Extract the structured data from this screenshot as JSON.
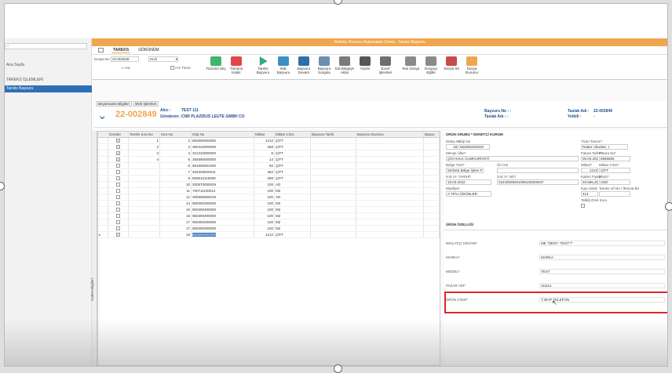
{
  "left_nav": {
    "search_placeholder": "",
    "items": [
      {
        "label": "Ana Sayfa",
        "active": false
      },
      {
        "label": "TAREKS İŞLEMLERİ",
        "active": false
      },
      {
        "label": "Tareks Başvuru",
        "active": true
      }
    ]
  },
  "titlebar": {
    "title": "Robotic Process Automation Demo - Tareks Başvuru"
  },
  "ribbon_tabs": [
    "TAREKS",
    "GÖRÜNÜM"
  ],
  "ribbon": {
    "dosya_no_label": "Dosya No",
    "dosya_no_value": "22-002849",
    "hizli_value": "Hızlı",
    "ara_label": "Ara",
    "hiz_tumu_label": "Hız Tümü",
    "buttons": [
      "Tümünü Seç",
      "Tümünü Kaldır",
      "Tareks Başvuru",
      "XML Başvuru",
      "Başvuru Devam",
      "Başvuru Sorgula",
      "Edi Belgeye Aktar",
      "Yazdır",
      "Excel İşlemleri",
      "Yeni Dosya",
      "Dosyayı Eğitle",
      "Dosya Sil",
      "Dosya Durumu"
    ]
  },
  "info": {
    "tabs": [
      "Beyanname Bilgileri",
      "Web İşlemleri"
    ],
    "file_no": "22-002849",
    "alici_label": "Alıcı :",
    "alici_value": "TEST 111",
    "gonderen_label": "Gönderen :",
    "gonderen_value": "CNR PLAZIDUS LEUTE GMBH CO",
    "basvuru_no_label": "Başvuru No : -",
    "taslak_adi_label": "Taslak Adı :",
    "taslak_adi_value": "22-002849",
    "tarih_label": "Taslak Adı : -",
    "yetkili_label": "Yetkili :",
    "yetkili_value": "-"
  },
  "grid": {
    "side_label": "Kalem Bilgileri",
    "headers": [
      "Gönder",
      "Tareks Sıra No",
      "Sıra No",
      "Gtip No",
      "Miktar",
      "Miktar Cinsi",
      "Başvuru Tarihi",
      "Başvuru Durumu",
      "Başvu"
    ],
    "rows": [
      {
        "send": true,
        "tareks": "1",
        "sira": "2",
        "gtip": "852692002000",
        "miktar": "1212",
        "cins": "ÇİFT"
      },
      {
        "send": true,
        "tareks": "2",
        "sira": "3",
        "gtip": "360410000000",
        "miktar": "368",
        "cins": "ÇİFT"
      },
      {
        "send": true,
        "tareks": "3",
        "sira": "4",
        "gtip": "321310000000",
        "miktar": "6",
        "cins": "ÇİFT"
      },
      {
        "send": true,
        "tareks": "4",
        "sira": "5",
        "gtip": "392690000000",
        "miktar": "14",
        "cins": "ÇİFT"
      },
      {
        "send": false,
        "tareks": "",
        "sira": "6",
        "gtip": "961900301000",
        "miktar": "92",
        "cins": "ÇİFT"
      },
      {
        "send": false,
        "tareks": "",
        "sira": "7",
        "gtip": "252329000011",
        "miktar": "362",
        "cins": "ÇİFT"
      },
      {
        "send": false,
        "tareks": "",
        "sira": "8",
        "gtip": "850610110000",
        "miktar": "299",
        "cins": "ÇİFT"
      },
      {
        "send": false,
        "tareks": "",
        "sira": "10",
        "gtip": "200570000029",
        "miktar": "100",
        "cins": "AD"
      },
      {
        "send": false,
        "tareks": "",
        "sira": "11",
        "gtip": "700711100012",
        "miktar": "100",
        "cins": "M2"
      },
      {
        "send": false,
        "tareks": "",
        "sira": "12",
        "gtip": "300590500019",
        "miktar": "100",
        "cins": "AD"
      },
      {
        "send": false,
        "tareks": "",
        "sira": "14",
        "gtip": "950300490000",
        "miktar": "100",
        "cins": "M2"
      },
      {
        "send": false,
        "tareks": "",
        "sira": "15",
        "gtip": "950300490000",
        "miktar": "100",
        "cins": "M2"
      },
      {
        "send": false,
        "tareks": "",
        "sira": "16",
        "gtip": "950300490000",
        "miktar": "100",
        "cins": "M2"
      },
      {
        "send": false,
        "tareks": "",
        "sira": "17",
        "gtip": "950300490000",
        "miktar": "100",
        "cins": "M2"
      },
      {
        "send": false,
        "tareks": "",
        "sira": "17",
        "gtip": "950300490000",
        "miktar": "100",
        "cins": "M2"
      },
      {
        "send": true,
        "tareks": "",
        "sira": "18",
        "gtip": "852692002000",
        "miktar": "1212",
        "cins": "ÇİFT"
      }
    ]
  },
  "detail": {
    "group_label": "ÜRÜN GRUBU * DENETÇİ KURUM",
    "detay_no_label": "Detay No",
    "gtip_no_label": "Gtip No",
    "detay_no_value": "18",
    "gtip_no_value": "852692002000",
    "ticari_tanimi_label": "Ticari Tanımı*",
    "ticari_tanimi_value": "Radar cihazları, t",
    "mense_label": "Menşe Ülke*",
    "mense_value": "ÇİN HALK CUMHURİYETİ",
    "fatura_tarihi_label": "Fatura Tarihi*",
    "fatura_tarihi_value": "06.04.2022",
    "fatura_no_label": "Fatura No*",
    "fatura_no_value": "5555555",
    "belge_turu_label": "Belge Türü*",
    "belge_turu_value": "Serbest Bölge İşlem F",
    "on_izin_label": "Ön İzin",
    "miktar_label": "Miktar*",
    "miktar_value": "1212",
    "miktar_cinsi_label": "Miktar Cinsi*",
    "miktar_cinsi_value": "ÇİFT",
    "sbif_tarihi_label": "S.B.İ.F. TARİHİ*",
    "sbif_tarihi_value": "16.03.2022",
    "sbif_no_label": "S.B.İ.F. NO*",
    "sbif_no_value": "22243008261096102825947",
    "kalem_fiyati_label": "Kalem Fiyatı*",
    "kalem_fiyati_value": "40.566,29",
    "doviz_label": "Döviz*",
    "doviz_value": "USD",
    "muafiyet_label": "Muafiyet",
    "muafiyet_value": "A.TR'LI ÜRÜNLER",
    "kap_adedi_label": "Kap Adedi",
    "kap_adedi_value": "414",
    "tareks_ref_label": "Tareks ref No / İhracat Be",
    "teblig_label": "Tebliğ Özel Soru",
    "urun_ozelligi_label": "ÜRÜN ÖZELLİĞİ",
    "imalatci_label": "İMALATÇI ÜNVANI*",
    "imalatci_value": "ME \"DENT -TEST\"/\"",
    "marka_label": "MARKA*",
    "marka_value": "MARKA",
    "model_label": "MODEL*",
    "model_value": "TEST",
    "pazar_adi_label": "PAZAR ADI*",
    "pazar_adi_value": "111111",
    "urun_cinsi_label": "ÜRÜN CİNSİ*",
    "urun_cinsi_value": "T.39-IP TELEFON"
  },
  "colors": {
    "accent": "#f0a64d",
    "nav_active": "#2f6fb6",
    "file_no": "#f0a64d",
    "highlight": "#e0262b",
    "selection": "#2f6fb6"
  }
}
